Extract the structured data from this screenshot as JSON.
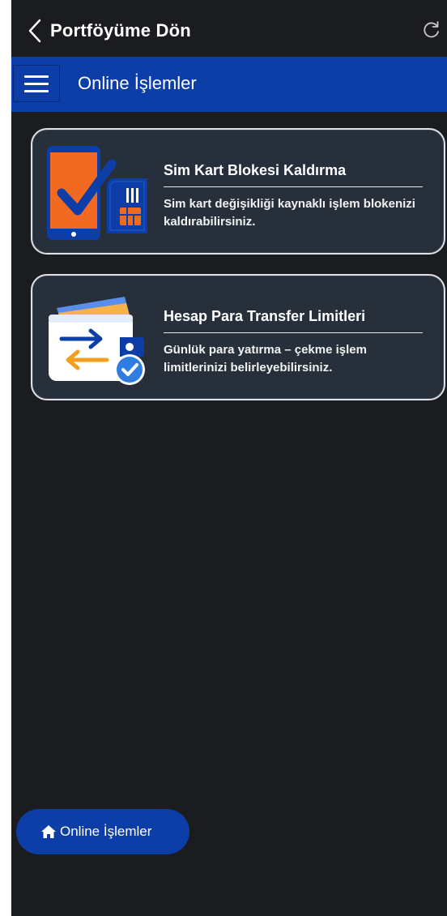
{
  "header": {
    "back_label": "Portföyüme Dön",
    "back_icon": "chevron-left-icon",
    "refresh_icon": "refresh-icon"
  },
  "navbar": {
    "menu_icon": "hamburger-menu-icon",
    "title": "Online İşlemler",
    "color": "#0d3da6"
  },
  "cards": [
    {
      "title": "Sim Kart Blokesi Kaldırma",
      "description": "Sim kart değişikliği kaynaklı işlem blokenizi kaldırabilirsiniz.",
      "icon": "phone-sim-check-icon"
    },
    {
      "title": "Hesap Para Transfer Limitleri",
      "description": "Günlük para yatırma – çekme işlem limitlerinizi belirleyebilirsiniz.",
      "icon": "wallet-transfer-check-icon"
    }
  ],
  "footer": {
    "home_icon": "home-icon",
    "home_label": "Online İşlemler"
  },
  "colors": {
    "background": "#1a1c20",
    "card_background": "#27303a",
    "accent_orange": "#f26a21",
    "accent_blue": "#0d3da6"
  }
}
